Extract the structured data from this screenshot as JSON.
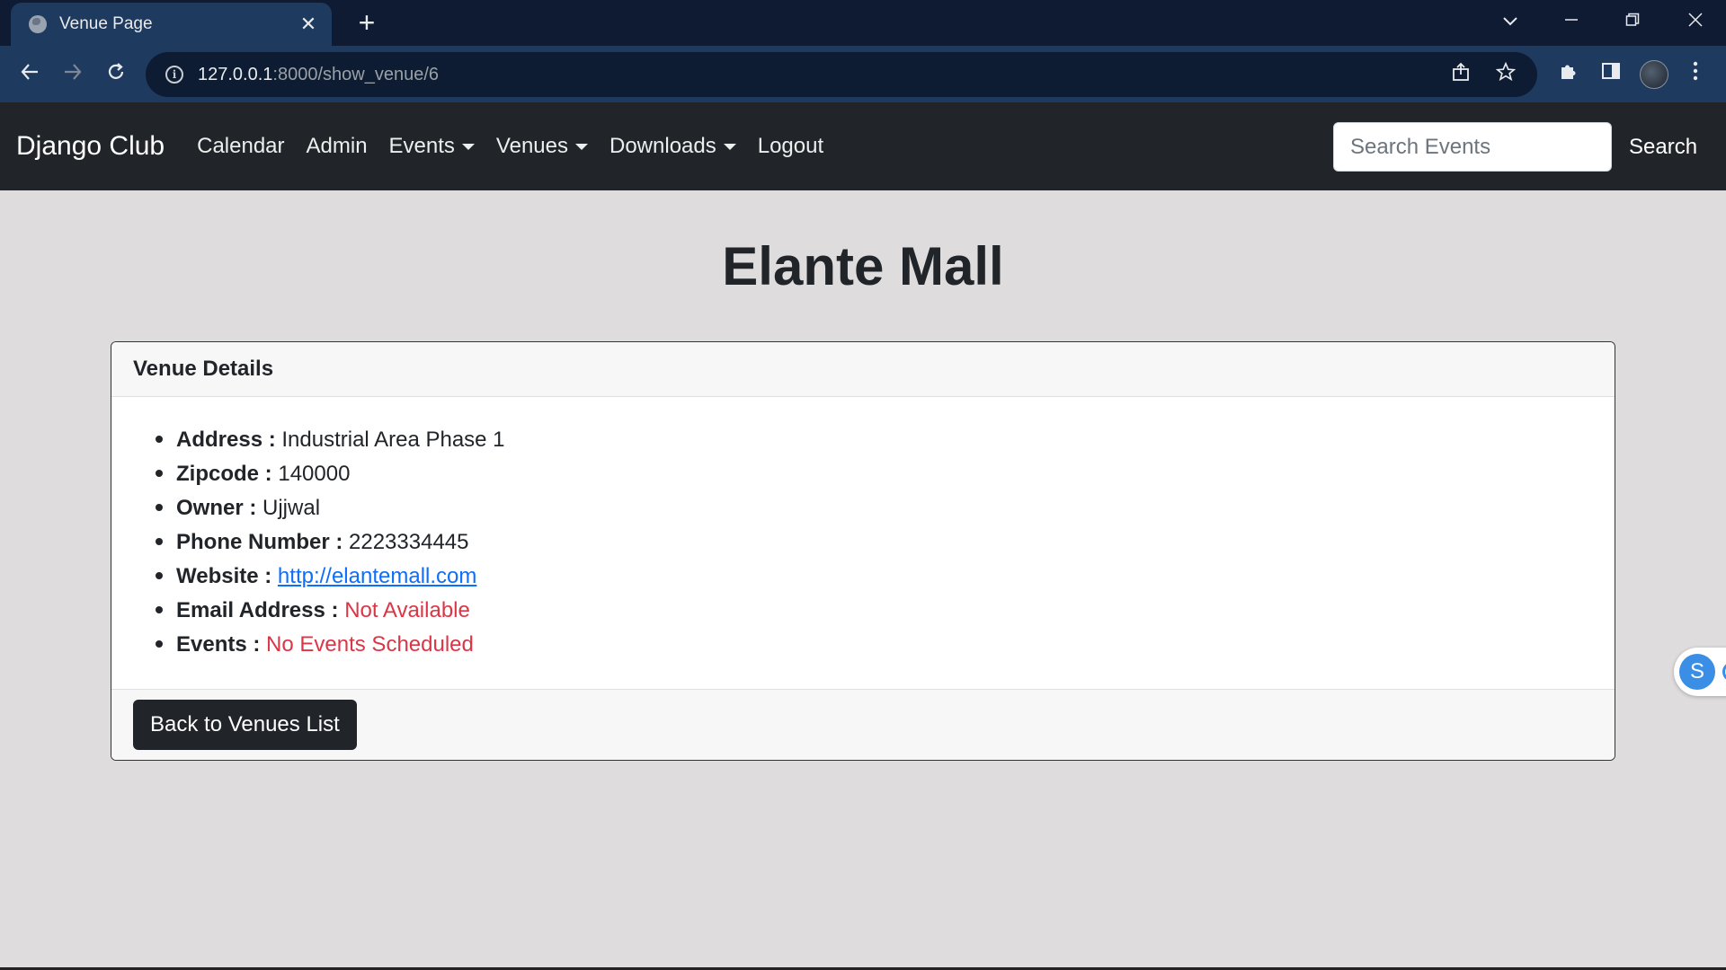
{
  "browser": {
    "tab_title": "Venue Page",
    "tab_close": "✕",
    "new_tab": "+",
    "url_host": "127.0.0.1",
    "url_rest": ":8000/show_venue/6",
    "icons": {
      "back": "arrow-left-icon",
      "forward": "arrow-right-icon",
      "reload": "reload-icon",
      "info": "info-icon",
      "share": "share-icon",
      "bookmark": "star-icon",
      "extensions": "puzzle-icon",
      "sidepanel": "side-panel-icon",
      "menu": "kebab-menu-icon"
    }
  },
  "navbar": {
    "brand": "Django Club",
    "links": [
      "Calendar",
      "Admin",
      "Events",
      "Venues",
      "Downloads",
      "Logout"
    ],
    "search_placeholder": "Search Events",
    "search_button": "Search"
  },
  "venue": {
    "name": "Elante Mall",
    "card_title": "Venue Details",
    "address_label": "Address :",
    "address": "Industrial Area Phase 1",
    "zipcode_label": "Zipcode :",
    "zipcode": "140000",
    "owner_label": "Owner :",
    "owner": "Ujjwal",
    "phone_label": "Phone Number :",
    "phone": "2223334445",
    "website_label": "Website :",
    "website": "http://elantemall.com",
    "email_label": "Email Address :",
    "email": "Not Available",
    "events_label": "Events :",
    "events": "No Events Scheduled",
    "back_button": "Back to Venues List"
  },
  "widget": {
    "letter": "S"
  },
  "colors": {
    "page_bg": "#dedcdd",
    "navbar_bg": "#212529",
    "danger": "#dc3545",
    "link": "#0d6efd",
    "chrome_bg": "#1f3a5f"
  }
}
